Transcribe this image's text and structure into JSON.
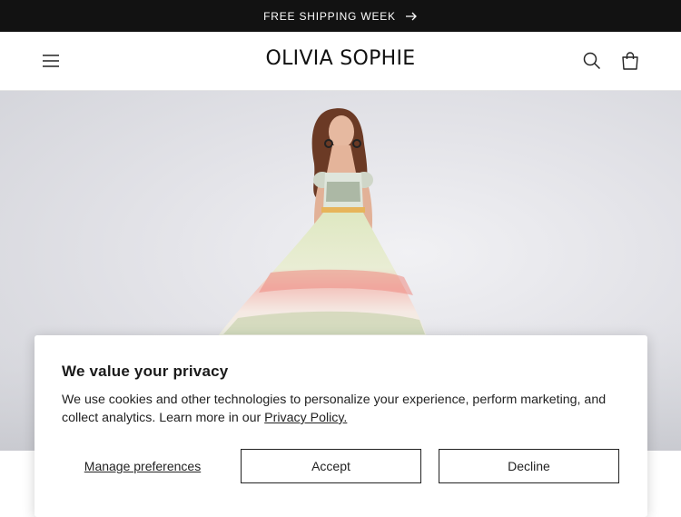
{
  "announcement": {
    "text": "FREE SHIPPING WEEK",
    "icon": "arrow-right-icon"
  },
  "header": {
    "logo": "OLIVIA SOPHIE",
    "menu_icon": "hamburger-menu-icon",
    "search_icon": "search-icon",
    "cart_icon": "shopping-bag-icon"
  },
  "hero": {
    "image": "model in floral tiered maxi dress"
  },
  "cookie_banner": {
    "title": "We value your privacy",
    "body": "We use cookies and other technologies to personalize your experience, perform marketing, and collect analytics. Learn more in our ",
    "policy_link": "Privacy Policy.",
    "manage_label": "Manage preferences",
    "accept_label": "Accept",
    "decline_label": "Decline"
  },
  "colors": {
    "announcement_bg": "#121212",
    "text": "#1a1a1a",
    "hero_bg": "#e3e3e8"
  }
}
